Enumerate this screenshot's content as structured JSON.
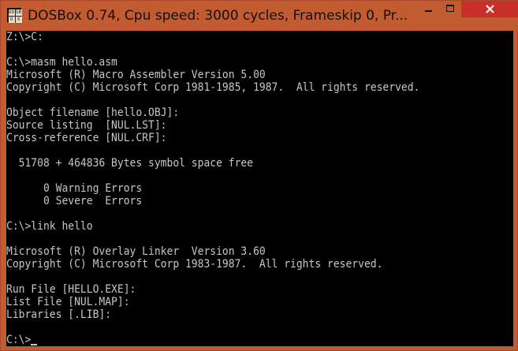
{
  "window": {
    "title": "DOSBox 0.74, Cpu speed:      3000 cycles, Frameskip  0, Pr...",
    "icon_letters": [
      "DO",
      "SB",
      "O",
      "X"
    ],
    "colors": {
      "titlebar": "#c25b30",
      "close_button": "#c9302c",
      "console_background": "#000000",
      "console_text": "#c6c6c6"
    }
  },
  "console": {
    "lines": [
      "Z:\\>C:",
      "",
      "C:\\>masm hello.asm",
      "Microsoft (R) Macro Assembler Version 5.00",
      "Copyright (C) Microsoft Corp 1981-1985, 1987.  All rights reserved.",
      "",
      "Object filename [hello.OBJ]:",
      "Source listing  [NUL.LST]:",
      "Cross-reference [NUL.CRF]:",
      "",
      "  51708 + 464836 Bytes symbol space free",
      "",
      "      0 Warning Errors",
      "      0 Severe  Errors",
      "",
      "C:\\>link hello",
      "",
      "Microsoft (R) Overlay Linker  Version 3.60",
      "Copyright (C) Microsoft Corp 1983-1987.  All rights reserved.",
      "",
      "Run File [HELLO.EXE]:",
      "List File [NUL.MAP]:",
      "Libraries [.LIB]:",
      "",
      "C:\\>"
    ]
  }
}
